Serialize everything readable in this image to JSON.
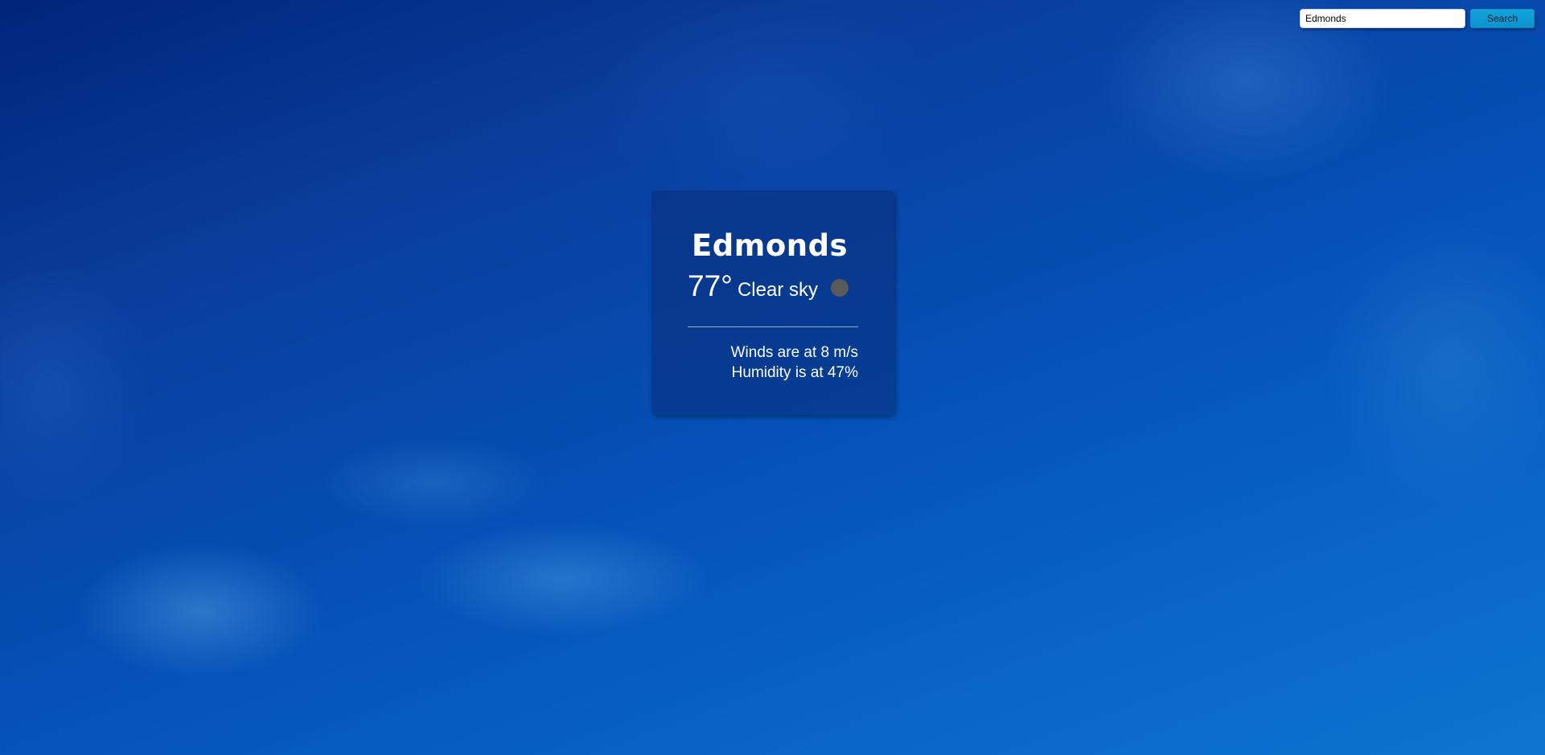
{
  "search": {
    "value": "Edmonds",
    "button_label": "Search"
  },
  "weather": {
    "city": "Edmonds",
    "temperature": "77°",
    "description": "Clear sky",
    "icon": "weather-condition-icon",
    "winds": "Winds are at 8 m/s",
    "humidity": "Humidity is at 47%"
  },
  "colors": {
    "background": "#0551b8",
    "card": "#0a2d78",
    "search_button": "#0a93cf",
    "text": "#ffffff"
  }
}
